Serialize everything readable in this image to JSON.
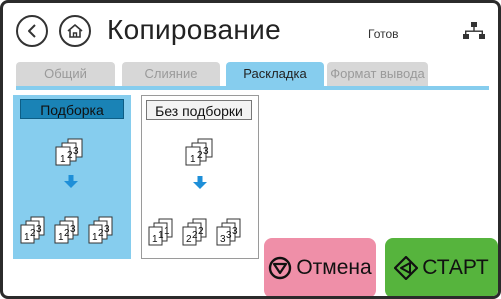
{
  "header": {
    "title": "Копирование",
    "status": "Готов",
    "back_icon": "back-chevron-icon",
    "home_icon": "home-icon",
    "network_icon": "network-icon"
  },
  "tabs": [
    {
      "label": "Общий",
      "active": false,
      "enabled": false
    },
    {
      "label": "Слияние",
      "active": false,
      "enabled": false
    },
    {
      "label": "Раскладка",
      "active": true,
      "enabled": true
    },
    {
      "label": "Формат вывода",
      "active": false,
      "enabled": false
    }
  ],
  "options": [
    {
      "label": "Подборка",
      "selected": true
    },
    {
      "label": "Без подборки",
      "selected": false
    }
  ],
  "actions": {
    "cancel_label": "Отмена",
    "start_label": "СТАРТ"
  },
  "colors": {
    "accent_blue": "#86cdee",
    "selected_label": "#1a83b6",
    "cancel": "#ef8fa8",
    "start": "#56b43d",
    "arrow": "#1e8fd8"
  }
}
